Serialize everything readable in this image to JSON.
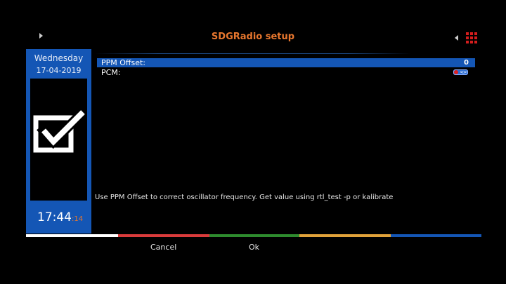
{
  "header": {
    "title": "SDGRadio setup",
    "left_arrow_icon": "triangle-right-icon",
    "right_arrow_icon": "triangle-left-icon",
    "menu_icon": "grid-menu-icon",
    "title_color": "#e8772e"
  },
  "side_panel": {
    "day": "Wednesday",
    "date": "17-04-2019",
    "icon": "checkbox-checked-icon",
    "time": "17:44",
    "seconds": ":14",
    "accent": "#1456b5"
  },
  "settings": {
    "items": [
      {
        "label": "PPM Offset:",
        "value": "0",
        "selected": true
      },
      {
        "label": "PCM:",
        "value_icon": "toggle-icon"
      }
    ]
  },
  "hint": "Use PPM Offset to correct oscillator frequency. Get value using rtl_test -p or kalibrate",
  "color_buttons": {
    "colors": [
      "#ffffff",
      "#d93b3b",
      "#2e8b2e",
      "#e0a23a",
      "#1456b5"
    ],
    "red_label": "Cancel",
    "green_label": "Ok"
  }
}
